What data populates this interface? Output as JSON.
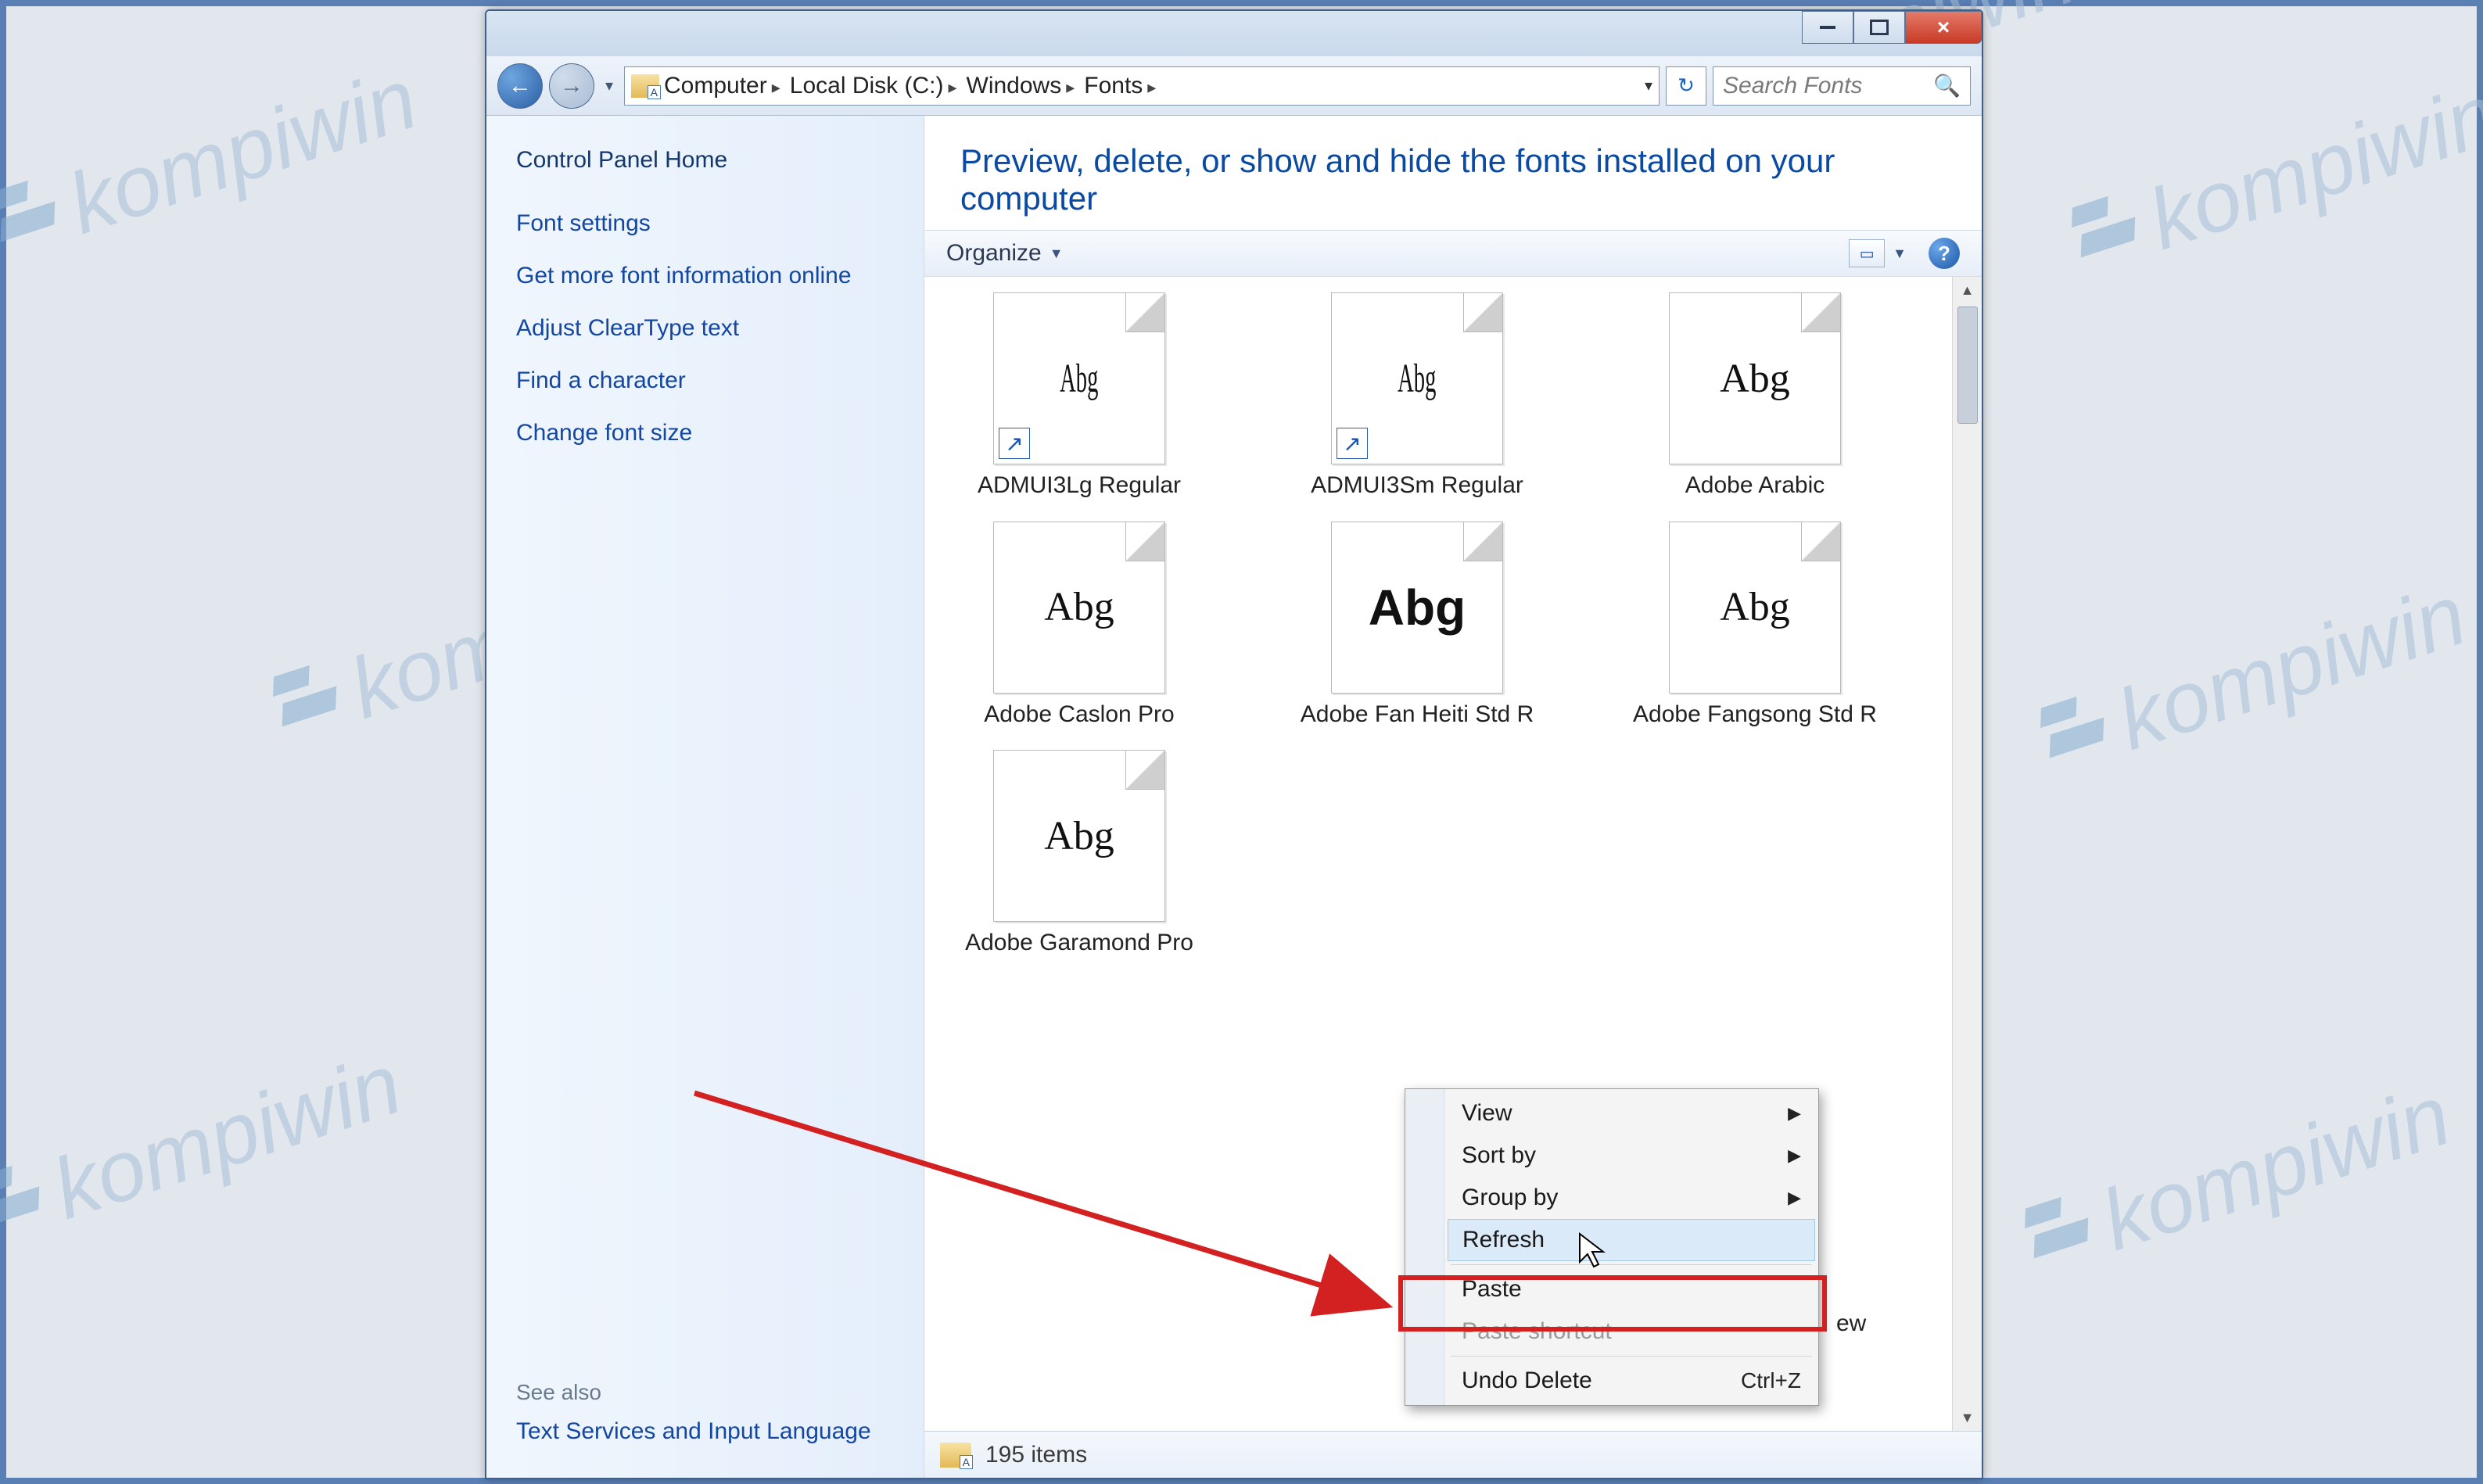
{
  "watermark_text": "kompiwin",
  "caption": {
    "min": "min",
    "max": "max",
    "close": "×"
  },
  "breadcrumb": [
    "Computer",
    "Local Disk (C:)",
    "Windows",
    "Fonts"
  ],
  "search_placeholder": "Search Fonts",
  "sidebar": {
    "cp_home": "Control Panel Home",
    "links": [
      "Font settings",
      "Get more font information online",
      "Adjust ClearType text",
      "Find a character",
      "Change font size"
    ],
    "see_also_heading": "See also",
    "see_also_links": [
      "Text Services and Input Language"
    ]
  },
  "main_heading": "Preview, delete, or show and hide the fonts installed on your computer",
  "toolbar": {
    "organize": "Organize"
  },
  "fonts": [
    {
      "label": "ADMUI3Lg Regular",
      "glyph": "Abg",
      "narrow": true,
      "stack": false,
      "shortcut": true
    },
    {
      "label": "ADMUI3Sm Regular",
      "glyph": "Abg",
      "narrow": true,
      "stack": false,
      "shortcut": true
    },
    {
      "label": "Adobe Arabic",
      "glyph": "Abg",
      "narrow": false,
      "stack": true,
      "shortcut": false
    },
    {
      "label": "Adobe Caslon Pro",
      "glyph": "Abg",
      "narrow": false,
      "stack": true,
      "shortcut": false
    },
    {
      "label": "Adobe Fan Heiti Std R",
      "glyph": "Abg",
      "narrow": false,
      "stack": false,
      "shortcut": false,
      "bold": true
    },
    {
      "label": "Adobe Fangsong Std R",
      "glyph": "Abg",
      "narrow": false,
      "stack": false,
      "shortcut": false
    },
    {
      "label": "Adobe Garamond Pro",
      "glyph": "Abg",
      "narrow": false,
      "stack": true,
      "shortcut": false
    }
  ],
  "context_menu": {
    "items": [
      {
        "label": "View",
        "submenu": true
      },
      {
        "label": "Sort by",
        "submenu": true
      },
      {
        "label": "Group by",
        "submenu": true
      },
      {
        "label": "Refresh",
        "hover": true
      },
      {
        "sep": true
      },
      {
        "label": "Paste",
        "highlighted": true
      },
      {
        "label": "Paste shortcut",
        "disabled": true
      },
      {
        "sep": true
      },
      {
        "label": "Undo Delete",
        "shortcut": "Ctrl+Z"
      }
    ]
  },
  "visible_extras": {
    "truncated_label": "ew"
  },
  "status": {
    "count_text": "195 items"
  }
}
